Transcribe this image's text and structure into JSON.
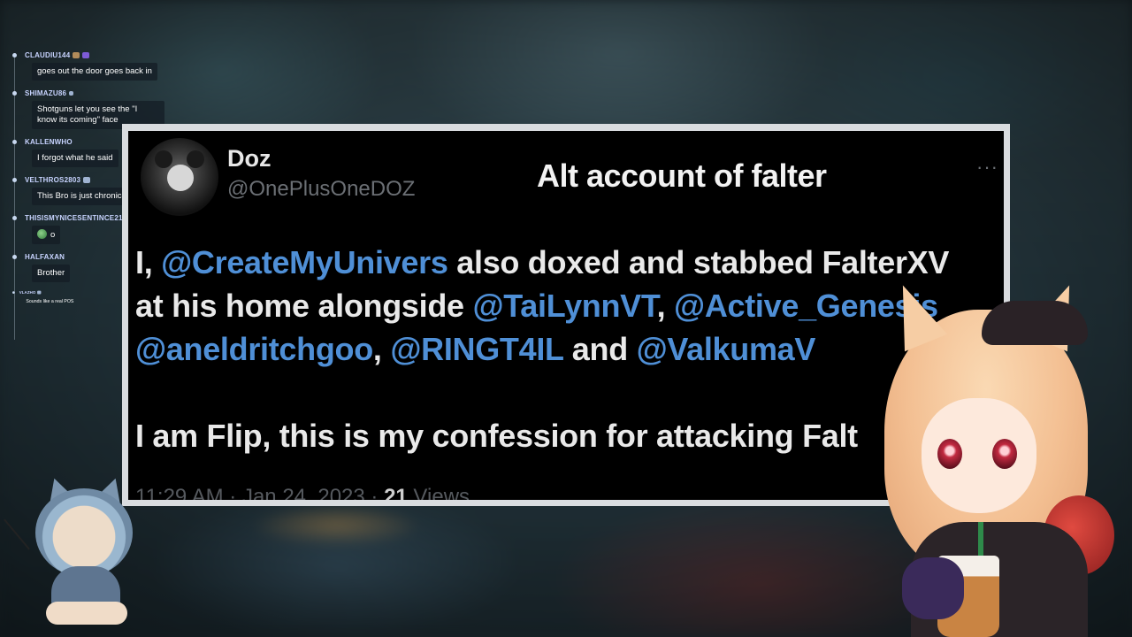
{
  "chat": {
    "messages": [
      {
        "user": "CLAUDIU144",
        "text": "goes out the door goes back in"
      },
      {
        "user": "SHIMAZU86",
        "text": "Shotguns let you see the \"I know its coming\" face"
      },
      {
        "user": "KALLENWHO",
        "text": "I forgot what he said"
      },
      {
        "user": "VELTHROS2803",
        "text": "This Bro is just chronically online"
      },
      {
        "user": "THISISMYNICESENTINCE2121",
        "text": "o"
      },
      {
        "user": "HALFAXAN",
        "text": "Brother"
      },
      {
        "user": "VLAZHO",
        "text": "Sounds like a real POS"
      }
    ],
    "colors": {
      "username": "#c8d4ff",
      "bubble": "rgba(20,28,36,.72)"
    }
  },
  "tweet": {
    "author_name": "Doz",
    "author_handle": "@OnePlusOneDOZ",
    "title": "Alt account of falter",
    "more_icon": "more-icon",
    "line1": {
      "p1": "I, ",
      "m1": "@CreateMyUnivers",
      "p2": " also doxed and stabbed FalterXV"
    },
    "line2": {
      "p1": "at his home alongside ",
      "m1": "@TaiLynnVT",
      "p2": ", ",
      "m2": "@Active_Genesis"
    },
    "line3": {
      "m1": "@aneldritchgoo",
      "p1": ", ",
      "m2": "@RINGT4IL",
      "p2": " and ",
      "m3": "@ValkumaV"
    },
    "line4": "I am Flip, this is my confession for attacking Falt",
    "timestamp": "11:29 AM · Jan 24, 2023 · ",
    "views_count": "21",
    "views_label": " Views",
    "colors": {
      "mention": "#4f8fd6",
      "text": "#e9e9e9",
      "frame": "#d9dcdf"
    }
  }
}
